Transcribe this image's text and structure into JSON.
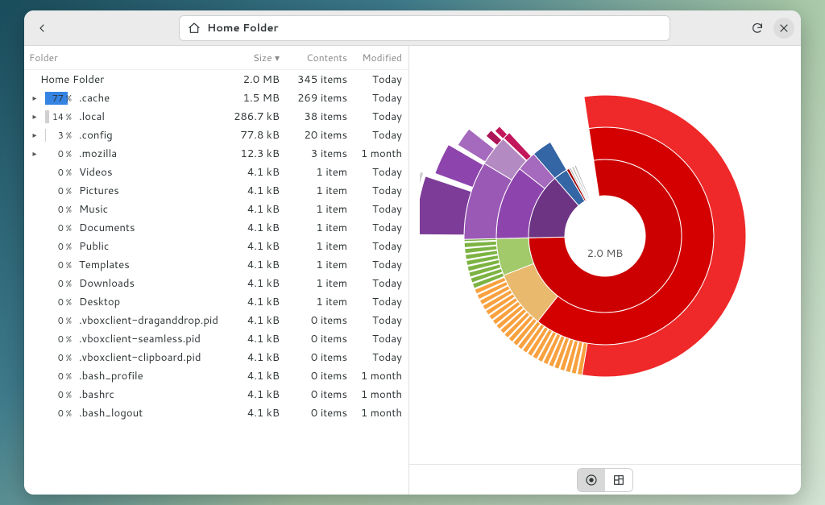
{
  "titlebar": {
    "path_label": "Home Folder"
  },
  "columns": {
    "folder": "Folder",
    "size": "Size",
    "contents": "Contents",
    "modified": "Modified"
  },
  "root_row": {
    "name": "Home Folder",
    "size": "2.0 MB",
    "items": "345 items",
    "mod": "Today"
  },
  "rows": [
    {
      "expand": true,
      "pct": "77 %",
      "pct_w": 77,
      "sel": true,
      "name": ".cache",
      "size": "1.5 MB",
      "items": "269 items",
      "mod": "Today"
    },
    {
      "expand": true,
      "pct": "14 %",
      "pct_w": 14,
      "sel": false,
      "name": ".local",
      "size": "286.7 kB",
      "items": "38 items",
      "mod": "Today"
    },
    {
      "expand": true,
      "pct": "3 %",
      "pct_w": 3,
      "sel": false,
      "name": ".config",
      "size": "77.8 kB",
      "items": "20 items",
      "mod": "Today"
    },
    {
      "expand": true,
      "pct": "0 %",
      "pct_w": 0,
      "sel": false,
      "name": ".mozilla",
      "size": "12.3 kB",
      "items": "3 items",
      "mod": "1 month"
    },
    {
      "expand": false,
      "pct": "0 %",
      "pct_w": 0,
      "sel": false,
      "name": "Videos",
      "size": "4.1 kB",
      "items": "1 item",
      "mod": "Today"
    },
    {
      "expand": false,
      "pct": "0 %",
      "pct_w": 0,
      "sel": false,
      "name": "Pictures",
      "size": "4.1 kB",
      "items": "1 item",
      "mod": "Today"
    },
    {
      "expand": false,
      "pct": "0 %",
      "pct_w": 0,
      "sel": false,
      "name": "Music",
      "size": "4.1 kB",
      "items": "1 item",
      "mod": "Today"
    },
    {
      "expand": false,
      "pct": "0 %",
      "pct_w": 0,
      "sel": false,
      "name": "Documents",
      "size": "4.1 kB",
      "items": "1 item",
      "mod": "Today"
    },
    {
      "expand": false,
      "pct": "0 %",
      "pct_w": 0,
      "sel": false,
      "name": "Public",
      "size": "4.1 kB",
      "items": "1 item",
      "mod": "Today"
    },
    {
      "expand": false,
      "pct": "0 %",
      "pct_w": 0,
      "sel": false,
      "name": "Templates",
      "size": "4.1 kB",
      "items": "1 item",
      "mod": "Today"
    },
    {
      "expand": false,
      "pct": "0 %",
      "pct_w": 0,
      "sel": false,
      "name": "Downloads",
      "size": "4.1 kB",
      "items": "1 item",
      "mod": "Today"
    },
    {
      "expand": false,
      "pct": "0 %",
      "pct_w": 0,
      "sel": false,
      "name": "Desktop",
      "size": "4.1 kB",
      "items": "1 item",
      "mod": "Today"
    },
    {
      "expand": false,
      "pct": "0 %",
      "pct_w": 0,
      "sel": false,
      "name": ".vboxclient-draganddrop.pid",
      "size": "4.1 kB",
      "items": "0 items",
      "mod": "Today"
    },
    {
      "expand": false,
      "pct": "0 %",
      "pct_w": 0,
      "sel": false,
      "name": ".vboxclient-seamless.pid",
      "size": "4.1 kB",
      "items": "0 items",
      "mod": "Today"
    },
    {
      "expand": false,
      "pct": "0 %",
      "pct_w": 0,
      "sel": false,
      "name": ".vboxclient-clipboard.pid",
      "size": "4.1 kB",
      "items": "0 items",
      "mod": "Today"
    },
    {
      "expand": false,
      "pct": "0 %",
      "pct_w": 0,
      "sel": false,
      "name": ".bash_profile",
      "size": "4.1 kB",
      "items": "0 items",
      "mod": "1 month"
    },
    {
      "expand": false,
      "pct": "0 %",
      "pct_w": 0,
      "sel": false,
      "name": ".bashrc",
      "size": "4.1 kB",
      "items": "0 items",
      "mod": "1 month"
    },
    {
      "expand": false,
      "pct": "0 %",
      "pct_w": 0,
      "sel": false,
      "name": ".bash_logout",
      "size": "4.1 kB",
      "items": "0 items",
      "mod": "1 month"
    }
  ],
  "center_size": "2.0 MB",
  "chart_data": {
    "type": "sunburst",
    "title": "",
    "center_label": "2.0 MB",
    "levels": 4,
    "start_angle_deg": -90,
    "rings": [
      {
        "level": 1,
        "segments": [
          {
            "name": ".cache",
            "fraction": 0.77,
            "color": "#cc0000"
          },
          {
            "name": ".local",
            "fraction": 0.14,
            "color": "#5c3566"
          },
          {
            "name": ".config",
            "fraction": 0.03,
            "color": "#204a87"
          },
          {
            "name": ".mozilla",
            "fraction": 0.006,
            "color": "#a40000"
          },
          {
            "name": "other",
            "fraction": 0.054,
            "color": "#888"
          }
        ]
      },
      {
        "level": 2,
        "segments": [
          {
            "parent": ".cache",
            "fraction": 0.7,
            "color": "#d40000"
          },
          {
            "parent": ".cache",
            "fraction": 0.07,
            "color": "#f57900"
          },
          {
            "parent": ".local",
            "fraction": 0.12,
            "color": "#75507b"
          },
          {
            "parent": ".local",
            "fraction": 0.02,
            "color": "#ad7fa8"
          },
          {
            "parent": ".config",
            "fraction": 0.03,
            "color": "#3465a4"
          }
        ]
      },
      {
        "level": 3,
        "segments": [
          {
            "parent": ".cache",
            "fraction": 0.6,
            "color": "#ef2929",
            "striped": true
          },
          {
            "parent": ".cache",
            "fraction": 0.1,
            "color": "#fcaf3e",
            "striped": true
          },
          {
            "parent": ".cache",
            "fraction": 0.07,
            "color": "#8ae234",
            "striped": true
          },
          {
            "parent": ".local",
            "fraction": 0.1,
            "color": "#9b59b6"
          },
          {
            "parent": ".local",
            "fraction": 0.02,
            "color": "#ad7fa8"
          }
        ]
      },
      {
        "level": 4,
        "segments": [
          {
            "parent": ".local",
            "fraction": 0.08,
            "color": "#8e44ad"
          },
          {
            "parent": ".local",
            "fraction": 0.02,
            "color": "#a569bd"
          }
        ]
      }
    ]
  }
}
